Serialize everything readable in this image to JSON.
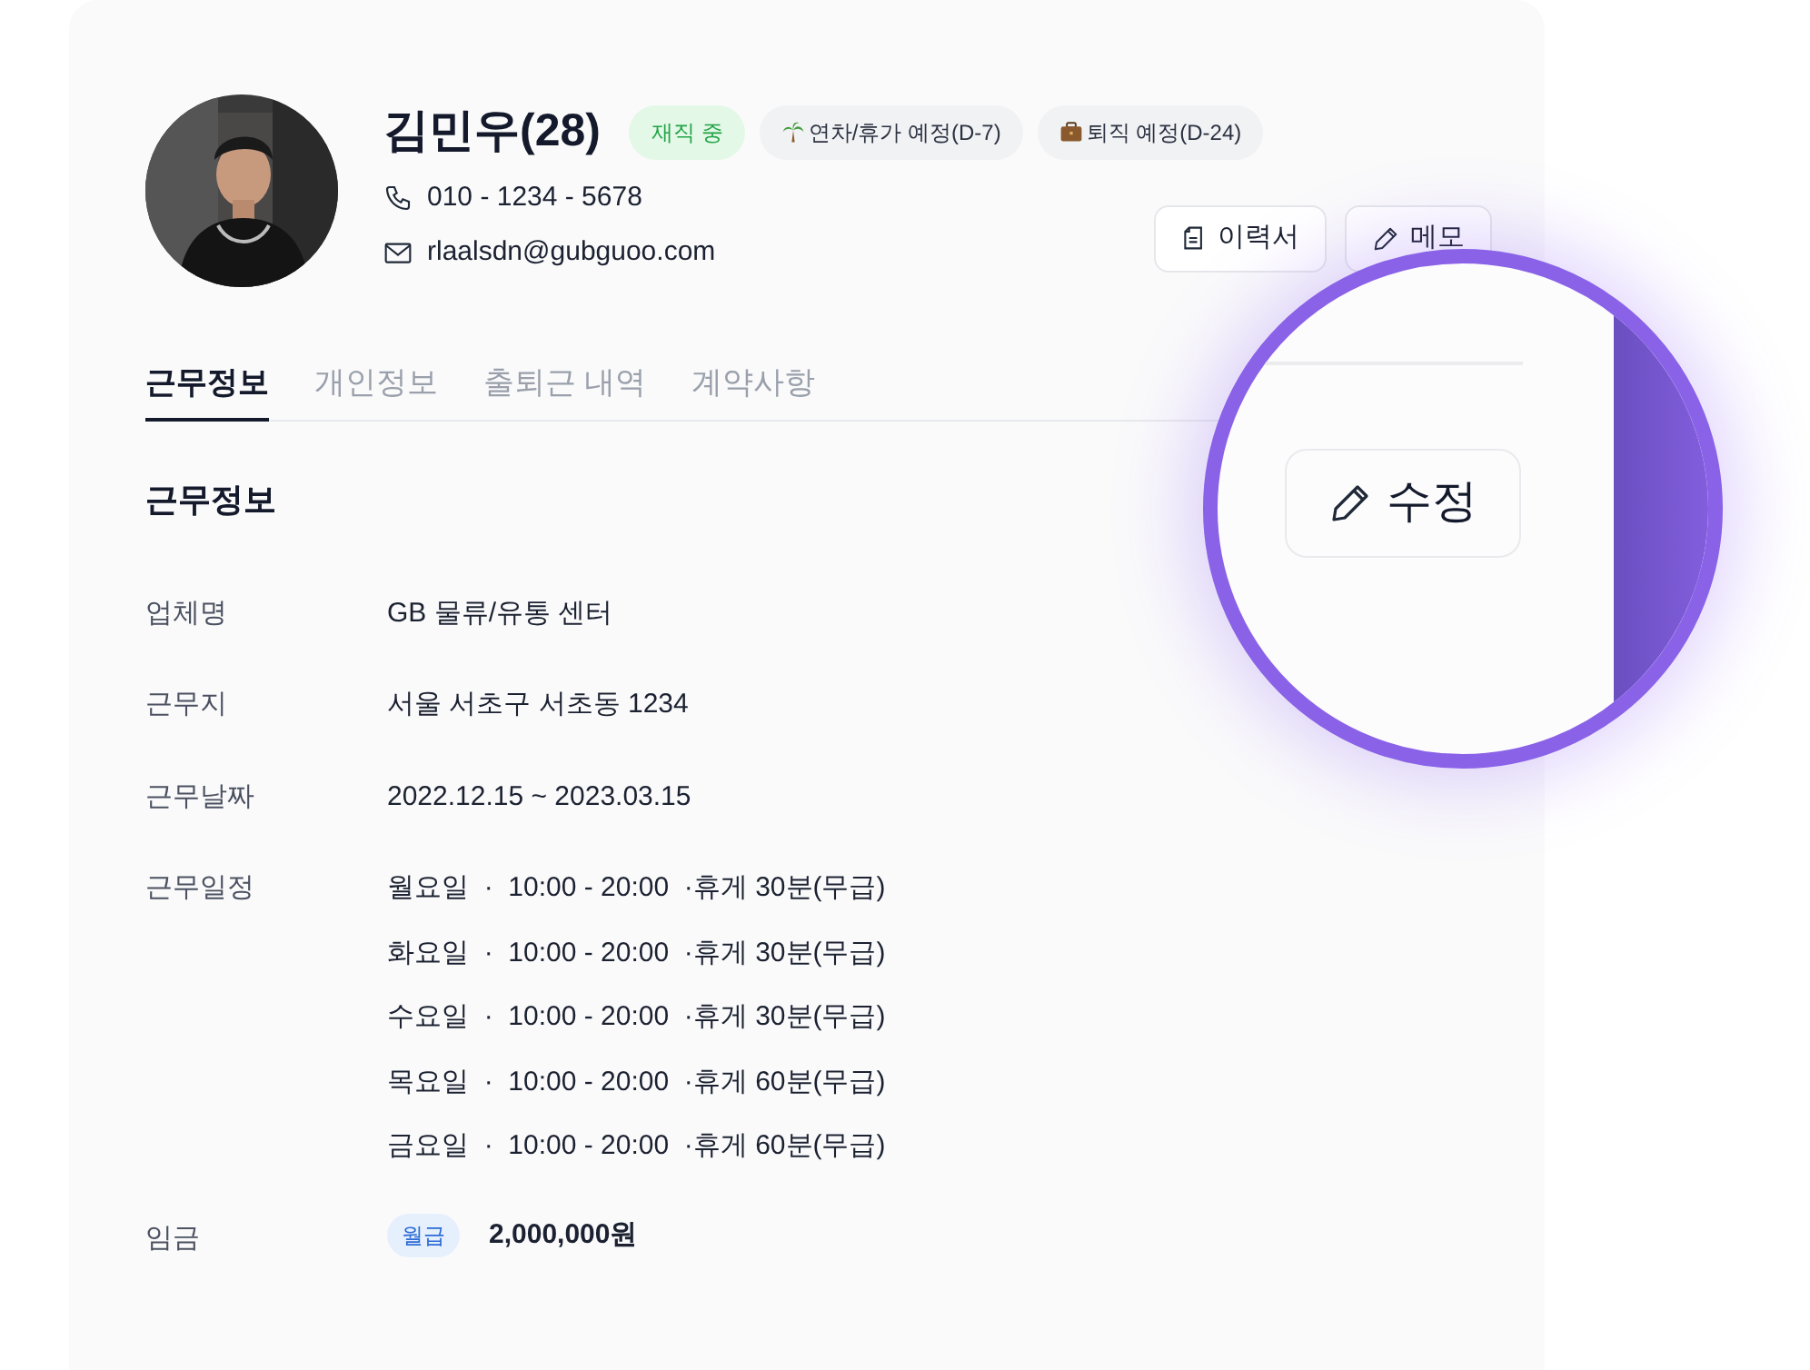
{
  "profile": {
    "name": "김민우(28)",
    "badges": [
      {
        "label": "재직 중",
        "kind": "status"
      },
      {
        "label": "연차/휴가 예정(D-7)",
        "kind": "vacation"
      },
      {
        "label": "퇴직 예정(D-24)",
        "kind": "resign"
      }
    ],
    "phone": "010 - 1234 - 5678",
    "email": "rlaalsdn@gubguoo.com",
    "buttons": [
      {
        "label": "이력서",
        "kind": "resume"
      },
      {
        "label": "메모",
        "kind": "memo"
      }
    ]
  },
  "tabs": [
    {
      "label": "근무정보",
      "selected": true
    },
    {
      "label": "개인정보",
      "selected": false
    },
    {
      "label": "출퇴근 내역",
      "selected": false
    },
    {
      "label": "계약사항",
      "selected": false
    }
  ],
  "section_title": "근무정보",
  "fields": [
    {
      "label": "업체명",
      "kind": "text",
      "value": "GB 물류/유통 센터"
    },
    {
      "label": "근무지",
      "kind": "text",
      "value": "서울 서초구 서초동  1234"
    },
    {
      "label": "근무날짜",
      "kind": "text",
      "value": "2022.12.15 ~ 2023.03.15"
    },
    {
      "label": "근무일정",
      "kind": "schedule",
      "lines": [
        "월요일  ·  10:00 - 20:00  ·휴게 30분(무급)",
        "화요일  ·  10:00 - 20:00  ·휴게 30분(무급)",
        "수요일  ·  10:00 - 20:00  ·휴게 30분(무급)",
        "목요일  ·  10:00 - 20:00  ·휴게 60분(무급)",
        "금요일  ·  10:00 - 20:00  ·휴게 60분(무급)"
      ]
    },
    {
      "label": "임금",
      "kind": "salary",
      "tag": "월급",
      "value": "2,000,000원"
    }
  ],
  "magnifier": {
    "button": "수정"
  }
}
